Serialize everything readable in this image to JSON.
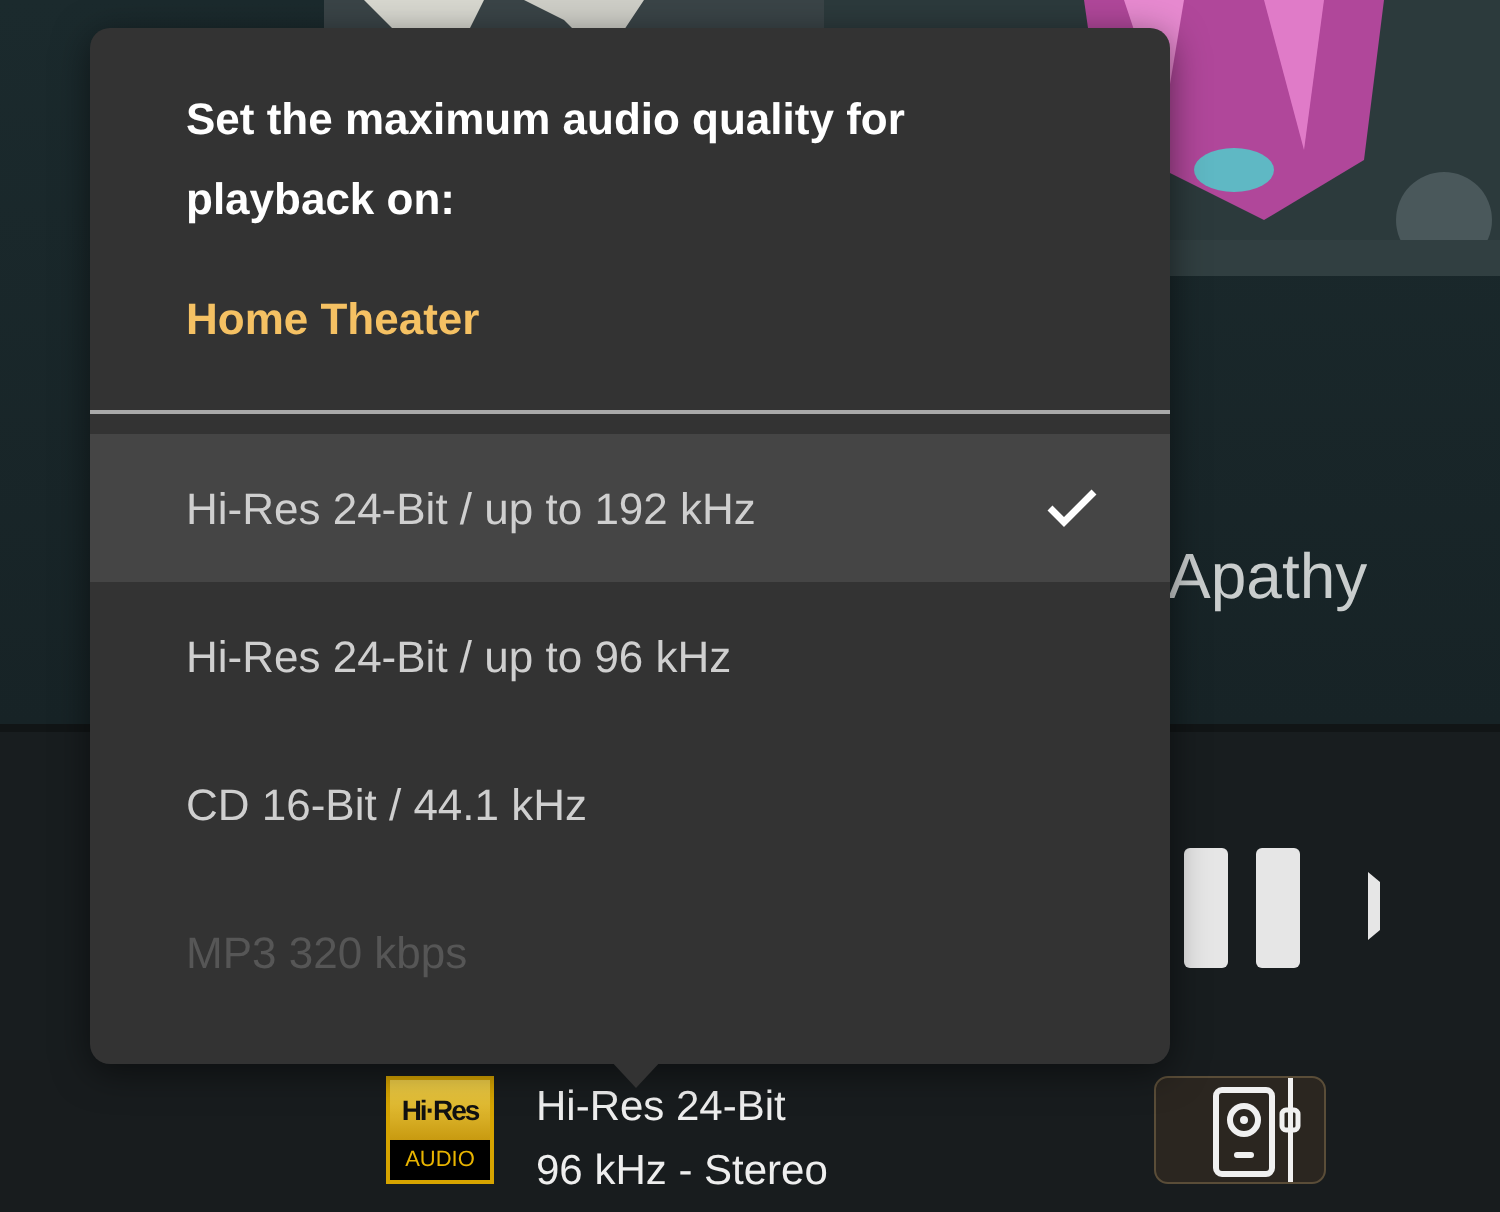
{
  "background": {
    "artist_line": "Apathy"
  },
  "popup": {
    "heading": "Set the maximum audio quality for playback on:",
    "device": "Home Theater",
    "options": [
      {
        "label": "Hi-Res 24-Bit / up to 192 kHz",
        "selected": true,
        "disabled": false
      },
      {
        "label": "Hi-Res 24-Bit / up to 96 kHz",
        "selected": false,
        "disabled": false
      },
      {
        "label": "CD 16-Bit / 44.1 kHz",
        "selected": false,
        "disabled": false
      },
      {
        "label": "MP3 320 kbps",
        "selected": false,
        "disabled": true
      }
    ]
  },
  "now_playing": {
    "badge_top": "Hi·Res",
    "badge_bottom": "AUDIO",
    "quality": "Hi-Res 24-Bit",
    "format": "96 kHz - Stereo"
  }
}
